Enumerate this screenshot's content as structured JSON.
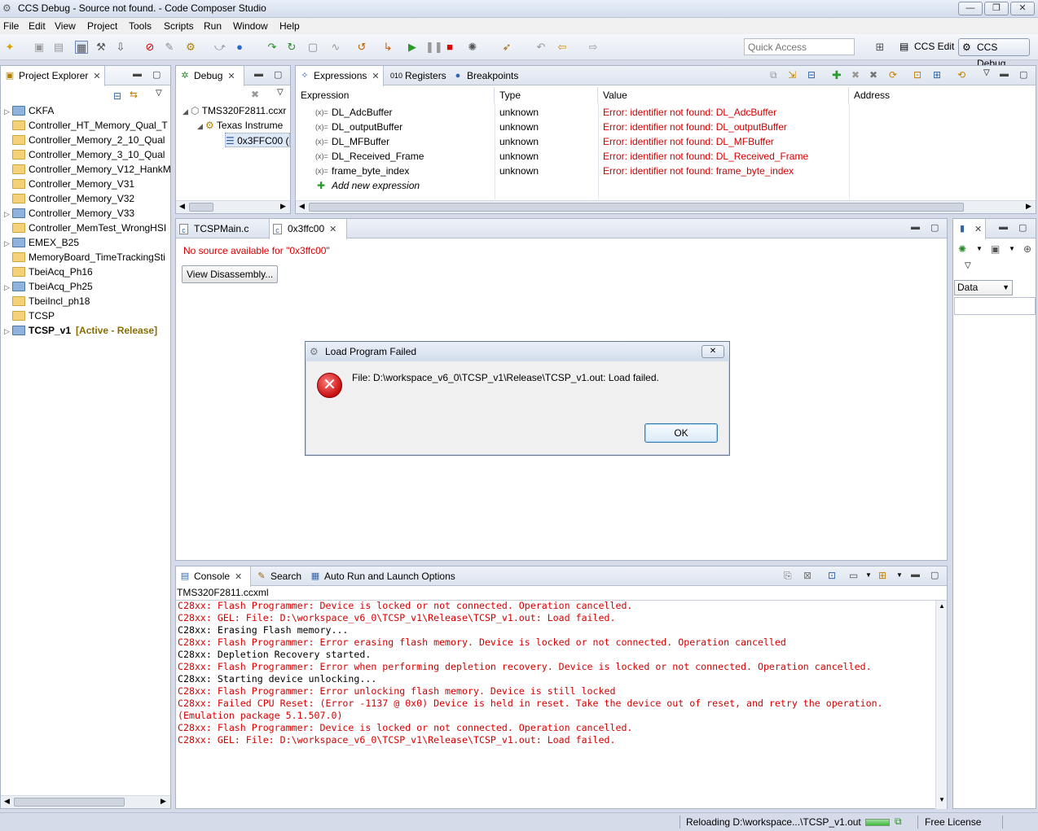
{
  "window": {
    "title": "CCS Debug - Source not found. - Code Composer Studio",
    "controls": [
      "—",
      "❐",
      "✕"
    ]
  },
  "menu": [
    "File",
    "Edit",
    "View",
    "Project",
    "Tools",
    "Scripts",
    "Run",
    "Window",
    "Help"
  ],
  "toolbar": {
    "quick_access_placeholder": "Quick Access",
    "perspectives": [
      "CCS Edit",
      "CCS Debug"
    ]
  },
  "project_explorer": {
    "title": "Project Explorer",
    "items": [
      {
        "label": "CKFA",
        "twisty": true,
        "type": "ccs"
      },
      {
        "label": "Controller_HT_Memory_Qual_T",
        "type": "folder"
      },
      {
        "label": "Controller_Memory_2_10_Qual",
        "type": "folder"
      },
      {
        "label": "Controller_Memory_3_10_Qual",
        "type": "folder"
      },
      {
        "label": "Controller_Memory_V12_HankM",
        "type": "folder"
      },
      {
        "label": "Controller_Memory_V31",
        "type": "folder"
      },
      {
        "label": "Controller_Memory_V32",
        "type": "folder"
      },
      {
        "label": "Controller_Memory_V33",
        "twisty": true,
        "type": "ccs"
      },
      {
        "label": "Controller_MemTest_WrongHSI",
        "type": "folder"
      },
      {
        "label": "EMEX_B25",
        "twisty": true,
        "type": "ccs"
      },
      {
        "label": "MemoryBoard_TimeTrackingSti",
        "type": "folder"
      },
      {
        "label": "TbeiAcq_Ph16",
        "type": "folder"
      },
      {
        "label": "TbeiAcq_Ph25",
        "twisty": true,
        "type": "ccs"
      },
      {
        "label": "TbeiIncl_ph18",
        "type": "folder"
      },
      {
        "label": "TCSP",
        "type": "folder"
      },
      {
        "label": "TCSP_v1",
        "twisty": true,
        "type": "ccs",
        "suffix": "[Active - Release]"
      }
    ]
  },
  "debug": {
    "title": "Debug",
    "rows": [
      "TMS320F2811.ccxr",
      "Texas Instrume",
      "0x3FFC00  ("
    ]
  },
  "expressions": {
    "tabs": [
      "Expressions",
      "Registers",
      "Breakpoints"
    ],
    "columns": [
      "Expression",
      "Type",
      "Value",
      "Address"
    ],
    "rows": [
      {
        "expr": "DL_AdcBuffer",
        "type": "unknown",
        "value": "Error: identifier not found: DL_AdcBuffer"
      },
      {
        "expr": "DL_outputBuffer",
        "type": "unknown",
        "value": "Error: identifier not found: DL_outputBuffer"
      },
      {
        "expr": "DL_MFBuffer",
        "type": "unknown",
        "value": "Error: identifier not found: DL_MFBuffer"
      },
      {
        "expr": "DL_Received_Frame",
        "type": "unknown",
        "value": "Error: identifier not found: DL_Received_Frame"
      },
      {
        "expr": "frame_byte_index",
        "type": "unknown",
        "value": "Error: identifier not found: frame_byte_index"
      }
    ],
    "add_new": "Add new expression",
    "var_icon": "(x)="
  },
  "editor": {
    "tabs": [
      "TCSPMain.c",
      "0x3ffc00"
    ],
    "no_source": "No source available for \"0x3ffc00\"",
    "view_disassembly": "View Disassembly..."
  },
  "right_panel": {
    "select_value": "Data"
  },
  "dialog": {
    "title": "Load Program Failed",
    "message": "File: D:\\workspace_v6_0\\TCSP_v1\\Release\\TCSP_v1.out: Load failed.",
    "ok": "OK",
    "close": "✕"
  },
  "console": {
    "tabs": [
      "Console",
      "Search",
      "Auto Run and Launch Options"
    ],
    "target": "TMS320F2811.ccxml",
    "lines": [
      {
        "text": "C28xx: Flash Programmer: Device is locked or not connected. Operation cancelled.",
        "err": true
      },
      {
        "text": "C28xx: GEL: File: D:\\workspace_v6_0\\TCSP_v1\\Release\\TCSP_v1.out: Load failed.",
        "err": true
      },
      {
        "text": "C28xx: Erasing Flash memory...",
        "err": false
      },
      {
        "text": "C28xx: Flash Programmer: Error erasing flash memory. Device is locked or not connected. Operation cancelled",
        "err": true
      },
      {
        "text": "C28xx: Depletion Recovery started.",
        "err": false
      },
      {
        "text": "C28xx: Flash Programmer: Error when performing depletion recovery. Device is locked or not connected. Operation cancelled.",
        "err": true
      },
      {
        "text": "C28xx: Starting device unlocking...",
        "err": false
      },
      {
        "text": "C28xx: Flash Programmer: Error unlocking flash memory. Device is still locked",
        "err": true
      },
      {
        "text": "C28xx: Failed CPU Reset: (Error -1137 @ 0x0) Device is held in reset. Take the device out of reset, and retry the operation.",
        "err": true
      },
      {
        "text": "(Emulation package 5.1.507.0)",
        "err": true
      },
      {
        "text": "C28xx: Flash Programmer: Device is locked or not connected. Operation cancelled.",
        "err": true
      },
      {
        "text": "C28xx: GEL: File: D:\\workspace_v6_0\\TCSP_v1\\Release\\TCSP_v1.out: Load failed.",
        "err": true
      }
    ]
  },
  "status": {
    "progress_text": "Reloading D:\\workspace...\\TCSP_v1.out",
    "license": "Free License"
  },
  "colors": {
    "error": "#d40000",
    "ccs_active": "#8a6d00"
  }
}
